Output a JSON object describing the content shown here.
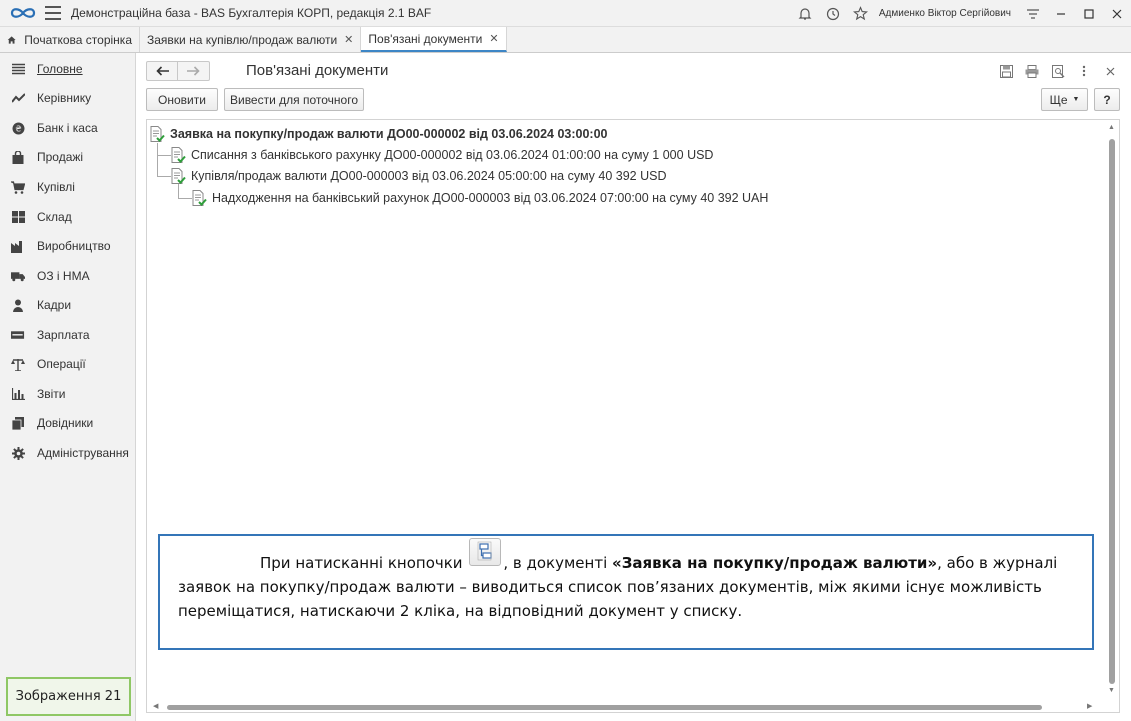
{
  "window": {
    "app_title": "Демонстраційна база - BAS Бухгалтерія КОРП, редакція 2.1 BAF",
    "user_name": "Адмиенко Віктор Сергійович"
  },
  "tabs": [
    {
      "label": "Початкова сторінка"
    },
    {
      "label": "Заявки на купівлю/продаж валюти"
    },
    {
      "label": "Пов'язані документи"
    }
  ],
  "sidebar": {
    "items": [
      {
        "label": "Головне",
        "icon": "list-icon"
      },
      {
        "label": "Керівнику",
        "icon": "chart-line-icon"
      },
      {
        "label": "Банк і каса",
        "icon": "coin-icon"
      },
      {
        "label": "Продажі",
        "icon": "bag-icon"
      },
      {
        "label": "Купівлі",
        "icon": "cart-icon"
      },
      {
        "label": "Склад",
        "icon": "grid-icon"
      },
      {
        "label": "Виробництво",
        "icon": "factory-icon"
      },
      {
        "label": "ОЗ і НМА",
        "icon": "truck-icon"
      },
      {
        "label": "Кадри",
        "icon": "person-icon"
      },
      {
        "label": "Зарплата",
        "icon": "money-icon"
      },
      {
        "label": "Операції",
        "icon": "scales-icon"
      },
      {
        "label": "Звіти",
        "icon": "bar-chart-icon"
      },
      {
        "label": "Довідники",
        "icon": "books-icon"
      },
      {
        "label": "Адміністрування",
        "icon": "gear-icon"
      }
    ],
    "caption": "Зображення 21"
  },
  "form": {
    "title": "Пов'язані документи",
    "refresh_label": "Оновити",
    "output_label": "Вивести для поточного",
    "more_label": "Ще",
    "help_label": "?"
  },
  "tree": [
    {
      "text": "Заявка на покупку/продаж валюти ДО00-000002 від 03.06.2024 03:00:00",
      "level": 0
    },
    {
      "text": "Списання з банківського рахунку ДО00-000002 від 03.06.2024 01:00:00 на суму 1 000 USD",
      "level": 1
    },
    {
      "text": "Купівля/продаж валюти ДО00-000003 від 03.06.2024 05:00:00 на суму 40 392 USD",
      "level": 1
    },
    {
      "text": "Надходження на банківський рахунок ДО00-000003 від 03.06.2024 07:00:00 на суму 40 392 UAH",
      "level": 2
    }
  ],
  "note": {
    "part1": "При натисканні кнопочки",
    "part2": ", в документі ",
    "bold": "«Заявка на покупку/продаж валюти»",
    "part3": ", або в журналі заявок на покупку/продаж валюти – виводиться список пов’язаних документів, між якими існує можливість переміщатися, натискаючи 2 кліка, на відповідний документ у списку."
  },
  "colors": {
    "accent": "#3d86c6",
    "note_border": "#3475b8",
    "caption_border": "#8fc765",
    "check_green": "#2e9e3a"
  }
}
